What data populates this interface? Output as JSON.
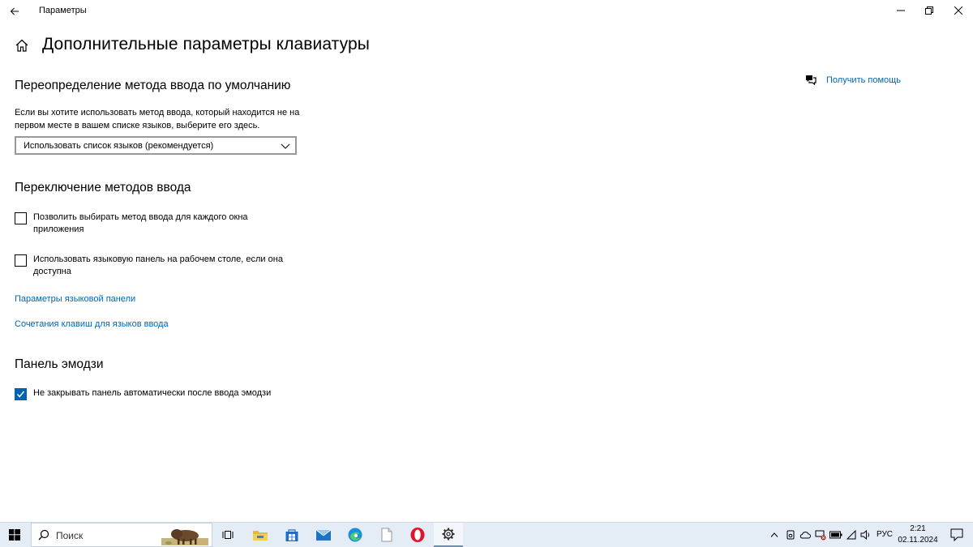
{
  "window": {
    "title": "Параметры"
  },
  "page": {
    "title": "Дополнительные параметры клавиатуры"
  },
  "help": {
    "label": "Получить помощь"
  },
  "override": {
    "title": "Переопределение метода ввода по умолчанию",
    "description": "Если вы хотите использовать метод ввода, который находится не на первом месте в вашем списке языков, выберите его здесь.",
    "selected": "Использовать список языков (рекомендуется)"
  },
  "switching": {
    "title": "Переключение методов ввода",
    "options": [
      {
        "label": "Позволить выбирать метод ввода для каждого окна приложения",
        "checked": false
      },
      {
        "label": "Использовать языковую панель на рабочем столе, если она доступна",
        "checked": false
      }
    ],
    "links": [
      "Параметры языковой панели",
      "Сочетания клавиш для языков ввода"
    ]
  },
  "emoji": {
    "title": "Панель эмодзи",
    "option": {
      "label": "Не закрывать панель автоматически после ввода эмодзи",
      "checked": true
    }
  },
  "taskbar": {
    "search_label": "Поиск",
    "apps": [
      "task-view-icon",
      "file-explorer-icon",
      "store-icon",
      "mail-icon",
      "edge-icon",
      "notepad-icon",
      "opera-icon",
      "settings-icon"
    ],
    "language": "РУС",
    "time": "2:21",
    "date": "02.11.2024"
  },
  "colors": {
    "accent": "#0063b1",
    "link": "#0067b8",
    "taskbar": "#e4ecf5"
  }
}
